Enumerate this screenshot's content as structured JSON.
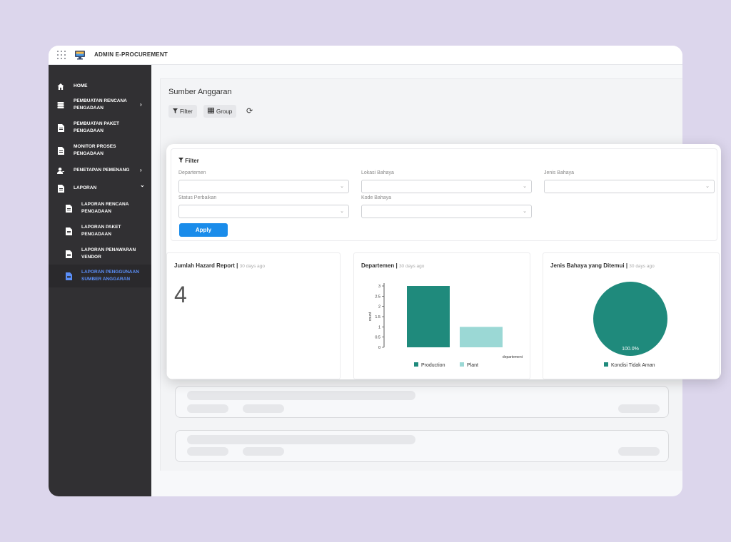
{
  "app": {
    "title": "ADMIN E-PROCUREMENT"
  },
  "sidebar": {
    "items": [
      {
        "label": "HOME",
        "icon": "home-icon"
      },
      {
        "label": "PEMBUATAN RENCANA PENGADAAN",
        "icon": "database-icon",
        "chevron": "›"
      },
      {
        "label": "PEMBUATAN PAKET PENGADAAN",
        "icon": "document-icon"
      },
      {
        "label": "MONITOR PROSES PENGADAAN",
        "icon": "document-icon"
      },
      {
        "label": "PENETAPAN PEMENANG",
        "icon": "user-icon",
        "chevron": "›"
      },
      {
        "label": "LAPORAN",
        "icon": "document-icon",
        "chevron": "⌄"
      },
      {
        "label": "LAPORAN RENCANA PENGADAAN",
        "icon": "document-icon"
      },
      {
        "label": "LAPORAN PAKET PENGADAAN",
        "icon": "document-icon"
      },
      {
        "label": "LAPORAN PENAWARAN VENDOR",
        "icon": "document-icon"
      },
      {
        "label": "LAPORAN PENGGUNAAN SUMBER ANGGARAN",
        "icon": "document-icon",
        "active": true
      }
    ]
  },
  "page": {
    "title": "Sumber Anggaran",
    "filter_button": "Filter",
    "group_button": "Group"
  },
  "filter": {
    "heading": "Filter",
    "fields": [
      "Departemen",
      "Lokasi Bahaya",
      "Jenis Bahaya",
      "Status Perbaikan",
      "Kode Bahaya"
    ],
    "apply_label": "Apply"
  },
  "cards": {
    "hazard": {
      "title": "Jumlah Hazard Report",
      "subtitle": "30 days ago",
      "value": "4"
    },
    "departemen": {
      "title": "Departemen",
      "subtitle": "30 days ago"
    },
    "jenis": {
      "title": "Jenis Bahaya yang Ditemui",
      "subtitle": "30 days ago"
    }
  },
  "colors": {
    "teal": "#1f8a7c",
    "light_teal": "#9bd8d5",
    "accent_blue": "#1a8cea",
    "sidebar_bg": "#313033"
  },
  "chart_data": [
    {
      "type": "bar",
      "categories": [
        "Production",
        "Plant"
      ],
      "values": [
        3,
        1
      ],
      "colors": [
        "#1f8a7c",
        "#9bd8d5"
      ],
      "xlabel": "departement",
      "ylabel": "count",
      "ylim": [
        0,
        3
      ],
      "yticks": [
        "0",
        "0.5",
        "1",
        "1.5",
        "2",
        "2.5",
        "3"
      ],
      "legend": [
        "Production",
        "Plant"
      ],
      "legend_position": "bottom"
    },
    {
      "type": "pie",
      "categories": [
        "Kondisi Tidak Aman"
      ],
      "values": [
        100
      ],
      "data_label": "100.0%",
      "colors": [
        "#1f8a7c"
      ],
      "legend": [
        "Kondisi Tidak Aman"
      ],
      "legend_position": "bottom"
    }
  ]
}
